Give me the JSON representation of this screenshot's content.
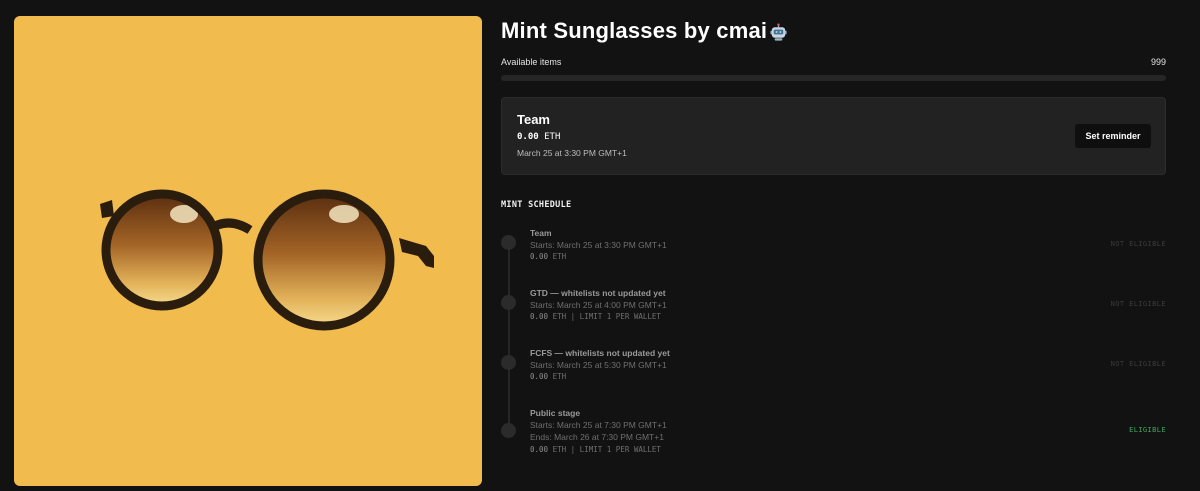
{
  "collection": {
    "title": "Mint Sunglasses by cmai",
    "badge_icon": "robot-icon"
  },
  "availability": {
    "label": "Available items",
    "count": "999",
    "progress": 0.0
  },
  "active_stage": {
    "name": "Team",
    "price_value": "0.00",
    "price_unit": "ETH",
    "date": "March 25 at 3:30 PM GMT+1",
    "reminder_label": "Set reminder"
  },
  "schedule": {
    "heading": "MINT SCHEDULE",
    "stages": [
      {
        "name": "Team",
        "starts": "Starts: March 25 at 3:30 PM GMT+1",
        "ends": "",
        "price_value": "0.00",
        "price_rest": " ETH",
        "status": "NOT ELIGIBLE"
      },
      {
        "name": "GTD — whitelists not updated yet",
        "starts": "Starts: March 25 at 4:00 PM GMT+1",
        "ends": "",
        "price_value": "0.00",
        "price_rest": " ETH | LIMIT 1 PER WALLET",
        "status": "NOT ELIGIBLE"
      },
      {
        "name": "FCFS — whitelists not updated yet",
        "starts": "Starts: March 25 at 5:30 PM GMT+1",
        "ends": "",
        "price_value": "0.00",
        "price_rest": " ETH",
        "status": "NOT ELIGIBLE"
      },
      {
        "name": "Public stage",
        "starts": "Starts: March 25 at 7:30 PM GMT+1",
        "ends": "Ends: March 26 at 7:30 PM GMT+1",
        "price_value": "0.00",
        "price_rest": " ETH | LIMIT 1 PER WALLET",
        "status": "ELIGIBLE"
      }
    ]
  },
  "colors": {
    "background": "#121212",
    "art_background": "#f1bb4d",
    "eligible": "#3fa460",
    "not_eligible": "#3b3b3b"
  }
}
